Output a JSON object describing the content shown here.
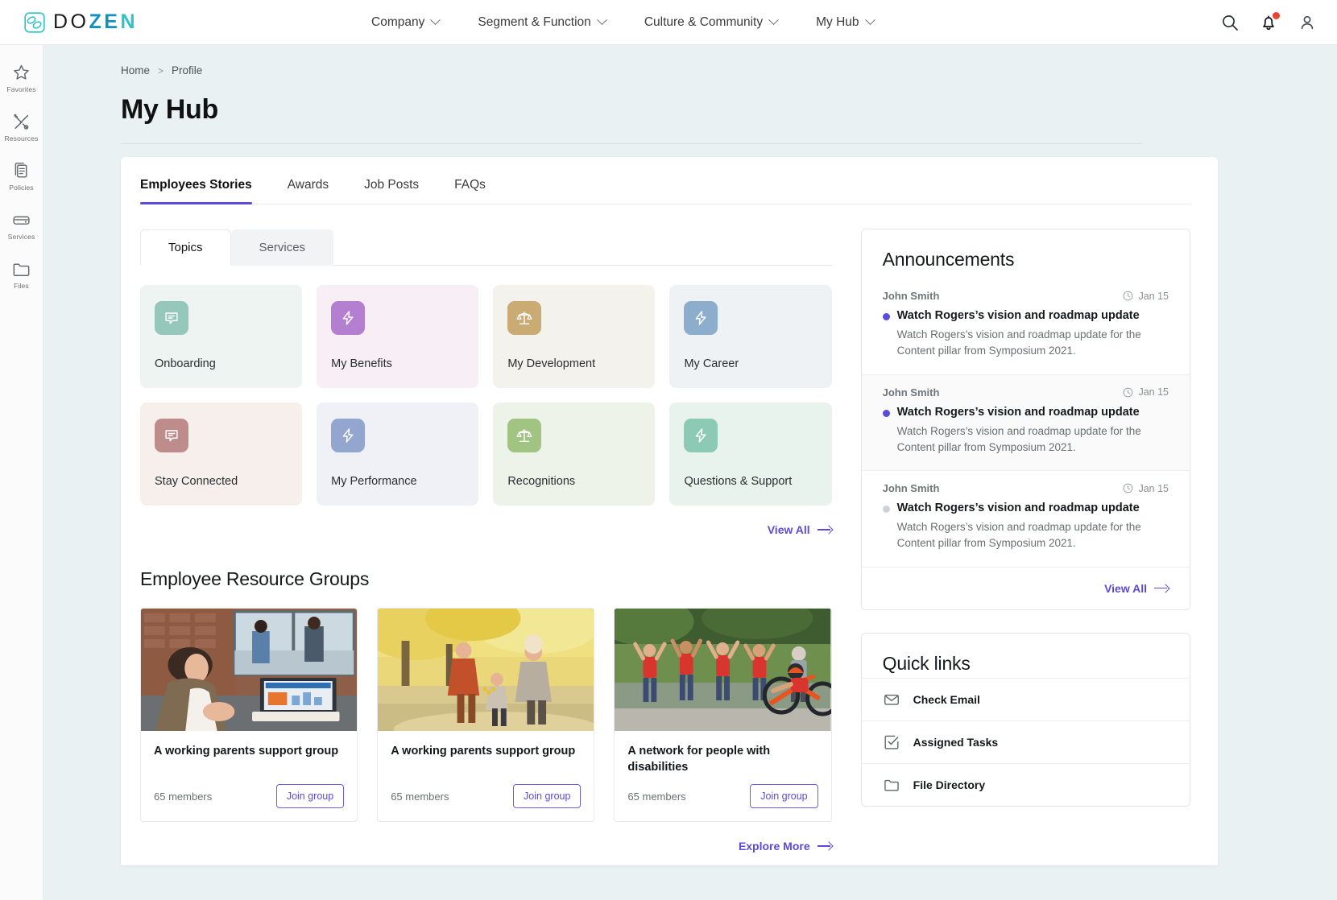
{
  "brand": {
    "part1": "DO",
    "part2": "ZE",
    "part3": "N",
    "logo_icon": "dozen-logo-icon"
  },
  "topnav": {
    "items": [
      {
        "label": "Company",
        "icon": "chevron-down-icon"
      },
      {
        "label": "Segment & Function",
        "icon": "chevron-down-icon"
      },
      {
        "label": "Culture & Community",
        "icon": "chevron-down-icon"
      },
      {
        "label": "My Hub",
        "icon": "chevron-down-icon"
      }
    ],
    "actions": [
      {
        "icon": "search-icon",
        "name": "search-button"
      },
      {
        "icon": "bell-icon",
        "name": "notifications-button",
        "badge": true
      },
      {
        "icon": "user-icon",
        "name": "account-button"
      }
    ]
  },
  "sidebar": {
    "items": [
      {
        "label": "Favorites",
        "icon": "star-icon"
      },
      {
        "label": "Resources",
        "icon": "tools-icon"
      },
      {
        "label": "Policies",
        "icon": "clipboard-icon"
      },
      {
        "label": "Services",
        "icon": "server-icon"
      },
      {
        "label": "Files",
        "icon": "folder-icon"
      }
    ]
  },
  "breadcrumb": {
    "home": "Home",
    "separator": ">",
    "current": "Profile"
  },
  "page": {
    "title": "My Hub"
  },
  "main_tabs": [
    {
      "label": "Employees Stories",
      "active": true
    },
    {
      "label": "Awards",
      "active": false
    },
    {
      "label": "Job Posts",
      "active": false
    },
    {
      "label": "FAQs",
      "active": false
    }
  ],
  "sub_tabs": [
    {
      "label": "Topics",
      "active": true
    },
    {
      "label": "Services",
      "active": false
    }
  ],
  "topics": [
    {
      "label": "Onboarding",
      "icon": "chat-bubble-icon",
      "card_bg": "#eef4f1",
      "icon_bg": "#95c7bb"
    },
    {
      "label": "My Benefits",
      "icon": "bolt-icon",
      "card_bg": "#f7eef6",
      "icon_bg": "#b47fd0"
    },
    {
      "label": "My Development",
      "icon": "scales-icon",
      "card_bg": "#f4f2ec",
      "icon_bg": "#cbab74"
    },
    {
      "label": "My Career",
      "icon": "bolt-icon",
      "card_bg": "#eef2f4",
      "icon_bg": "#8cadcb"
    },
    {
      "label": "Stay Connected",
      "icon": "chat-bubble-icon",
      "card_bg": "#f7efec",
      "icon_bg": "#bf8c8c"
    },
    {
      "label": "My Performance",
      "icon": "bolt-icon",
      "card_bg": "#eff1f6",
      "icon_bg": "#93a6cf"
    },
    {
      "label": "Recognitions",
      "icon": "scales-icon",
      "card_bg": "#eef3ea",
      "icon_bg": "#a2c483"
    },
    {
      "label": "Questions & Support",
      "icon": "bolt-icon",
      "card_bg": "#e8f3ee",
      "icon_bg": "#8ccab5"
    }
  ],
  "topics_view_all": {
    "label": "View All",
    "icon": "arrow-right-icon"
  },
  "erg": {
    "section_title": "Employee Resource Groups",
    "cards": [
      {
        "title": "A working parents support group",
        "members": "65 members",
        "button": "Join group",
        "image": "woman-at-desk-with-laptop-photo"
      },
      {
        "title": "A working parents support group",
        "members": "65 members",
        "button": "Join group",
        "image": "family-walking-autumn-path-photo"
      },
      {
        "title": "A network for people with disabilities",
        "members": "65 members",
        "button": "Join group",
        "image": "cyclist-with-cheering-volunteers-photo"
      }
    ],
    "explore": {
      "label": "Explore More",
      "icon": "arrow-right-icon"
    }
  },
  "announcements": {
    "title": "Announcements",
    "items": [
      {
        "author": "John Smith",
        "date": "Jan 15",
        "date_icon": "clock-icon",
        "title": "Watch Rogers’s vision and roadmap update",
        "desc": "Watch Rogers’s vision and roadmap update for the Content pillar from Symposium 2021.",
        "unread": true,
        "alt": false
      },
      {
        "author": "John Smith",
        "date": "Jan 15",
        "date_icon": "clock-icon",
        "title": "Watch Rogers’s vision and roadmap update",
        "desc": "Watch Rogers’s vision and roadmap update for the Content pillar from Symposium 2021.",
        "unread": true,
        "alt": true
      },
      {
        "author": "John Smith",
        "date": "Jan 15",
        "date_icon": "clock-icon",
        "title": "Watch Rogers’s vision and roadmap update",
        "desc": "Watch Rogers’s vision and roadmap update for the Content pillar from Symposium 2021.",
        "unread": false,
        "alt": false
      }
    ],
    "view_all": {
      "label": "View All",
      "icon": "arrow-right-icon"
    }
  },
  "quick_links": {
    "title": "Quick links",
    "items": [
      {
        "label": "Check Email",
        "icon": "envelope-icon"
      },
      {
        "label": "Assigned Tasks",
        "icon": "checkbox-check-icon"
      },
      {
        "label": "File Directory",
        "icon": "folder-icon"
      }
    ]
  },
  "colors": {
    "accent": "#5b4bdc",
    "brand_blue": "#1490bf",
    "brand_teal": "#2cc3c9",
    "badge_red": "#ef4030",
    "page_bg": "#e9f1f3"
  }
}
